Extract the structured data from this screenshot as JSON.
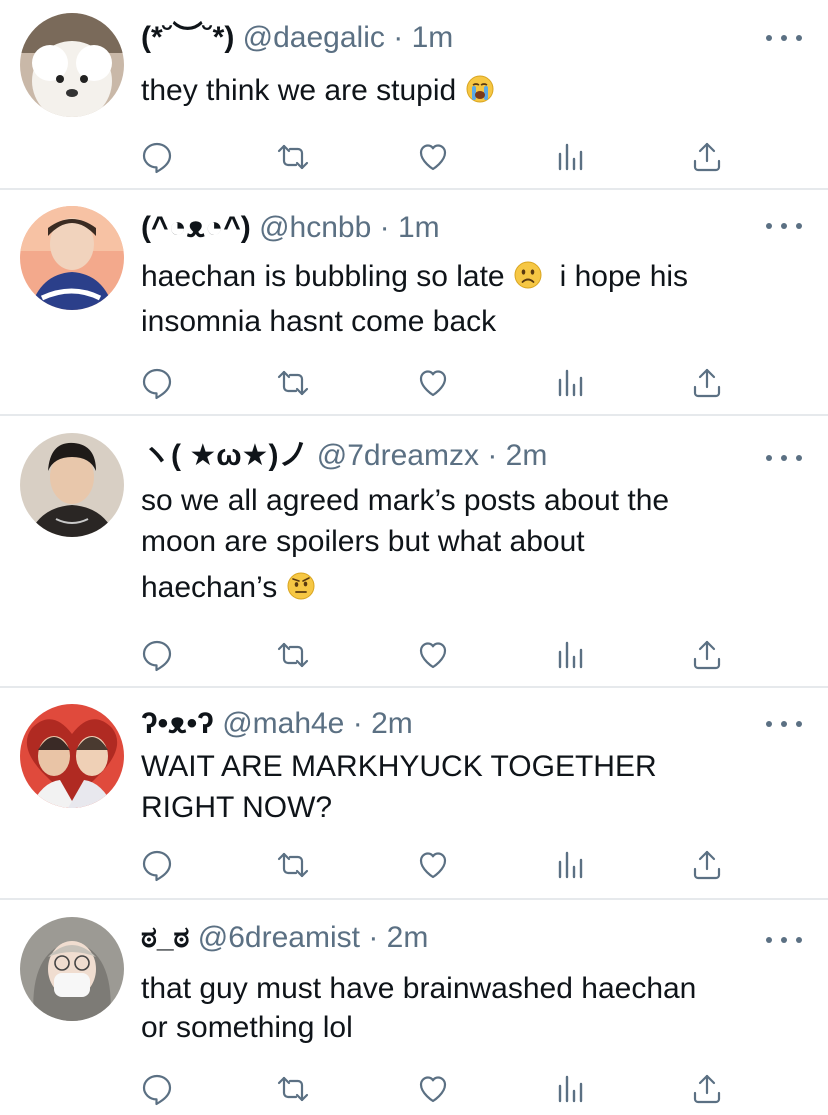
{
  "tweets": [
    {
      "display_name": "(*˘︶˘*)",
      "handle": "@daegalic",
      "time": "1m",
      "lines": [
        "they think we are stupid"
      ],
      "emoji": "loudly-crying-face-emoji"
    },
    {
      "display_name": "(^◔ᴥ◔^)",
      "handle": "@hcnbb",
      "time": "1m",
      "lines": [
        "haechan is bubbling so late",
        "i hope his",
        "insomnia hasnt come back"
      ],
      "emoji": "slightly-frowning-face-emoji"
    },
    {
      "display_name": "ヽ( ★ω★)ノ",
      "handle": "@7dreamzx",
      "time": "2m",
      "lines": [
        "so we all agreed mark’s posts about the",
        "moon are spoilers but what about",
        "haechan’s"
      ],
      "emoji": "face-with-raised-eyebrow-emoji"
    },
    {
      "display_name": "ʔ•ᴥ•ʔ",
      "handle": "@mah4e",
      "time": "2m",
      "lines": [
        "WAIT ARE MARKHYUCK TOGETHER",
        "RIGHT NOW?"
      ]
    },
    {
      "display_name": "ಠ_ಠ",
      "handle": "@6dreamist",
      "time": "2m",
      "lines": [
        "that guy must have brainwashed haechan",
        "or something lol"
      ]
    }
  ],
  "separator": "·",
  "action_icons": [
    "reply-icon",
    "retweet-icon",
    "like-icon",
    "analytics-icon",
    "share-icon"
  ],
  "colors": {
    "text": "#0f1419",
    "secondary": "#5b7083",
    "divider": "#e6e9ec",
    "background": "#ffffff"
  }
}
